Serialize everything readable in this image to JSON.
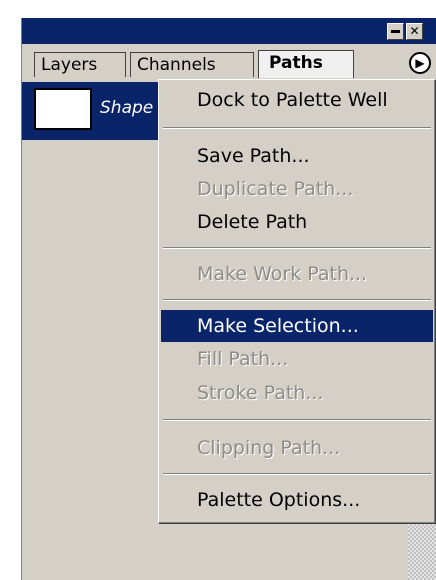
{
  "titlebar": {
    "minimize_glyph": "▬",
    "close_glyph": "✕"
  },
  "tabs": [
    {
      "label": "Layers",
      "active": false
    },
    {
      "label": "Channels",
      "active": false
    },
    {
      "label": "Paths",
      "active": true
    }
  ],
  "palette_menu_glyph": "▶",
  "paths_list": [
    {
      "label": "Shape",
      "selected": true
    }
  ],
  "context_menu": {
    "items": [
      {
        "label": "Dock to Palette Well",
        "enabled": true,
        "highlighted": false
      },
      {
        "label": "Save Path...",
        "enabled": true,
        "highlighted": false
      },
      {
        "label": "Duplicate Path...",
        "enabled": false,
        "highlighted": false
      },
      {
        "label": "Delete Path",
        "enabled": true,
        "highlighted": false
      },
      {
        "label": "Make Work Path...",
        "enabled": false,
        "highlighted": false
      },
      {
        "label": "Make Selection...",
        "enabled": true,
        "highlighted": true
      },
      {
        "label": "Fill Path...",
        "enabled": false,
        "highlighted": false
      },
      {
        "label": "Stroke Path...",
        "enabled": false,
        "highlighted": false
      },
      {
        "label": "Clipping Path...",
        "enabled": false,
        "highlighted": false
      },
      {
        "label": "Palette Options...",
        "enabled": true,
        "highlighted": false
      }
    ]
  },
  "colors": {
    "titlebar": "#0a246a",
    "highlight": "#0a246a",
    "face": "#d4d0c8",
    "disabled_text": "#8e8c86"
  }
}
